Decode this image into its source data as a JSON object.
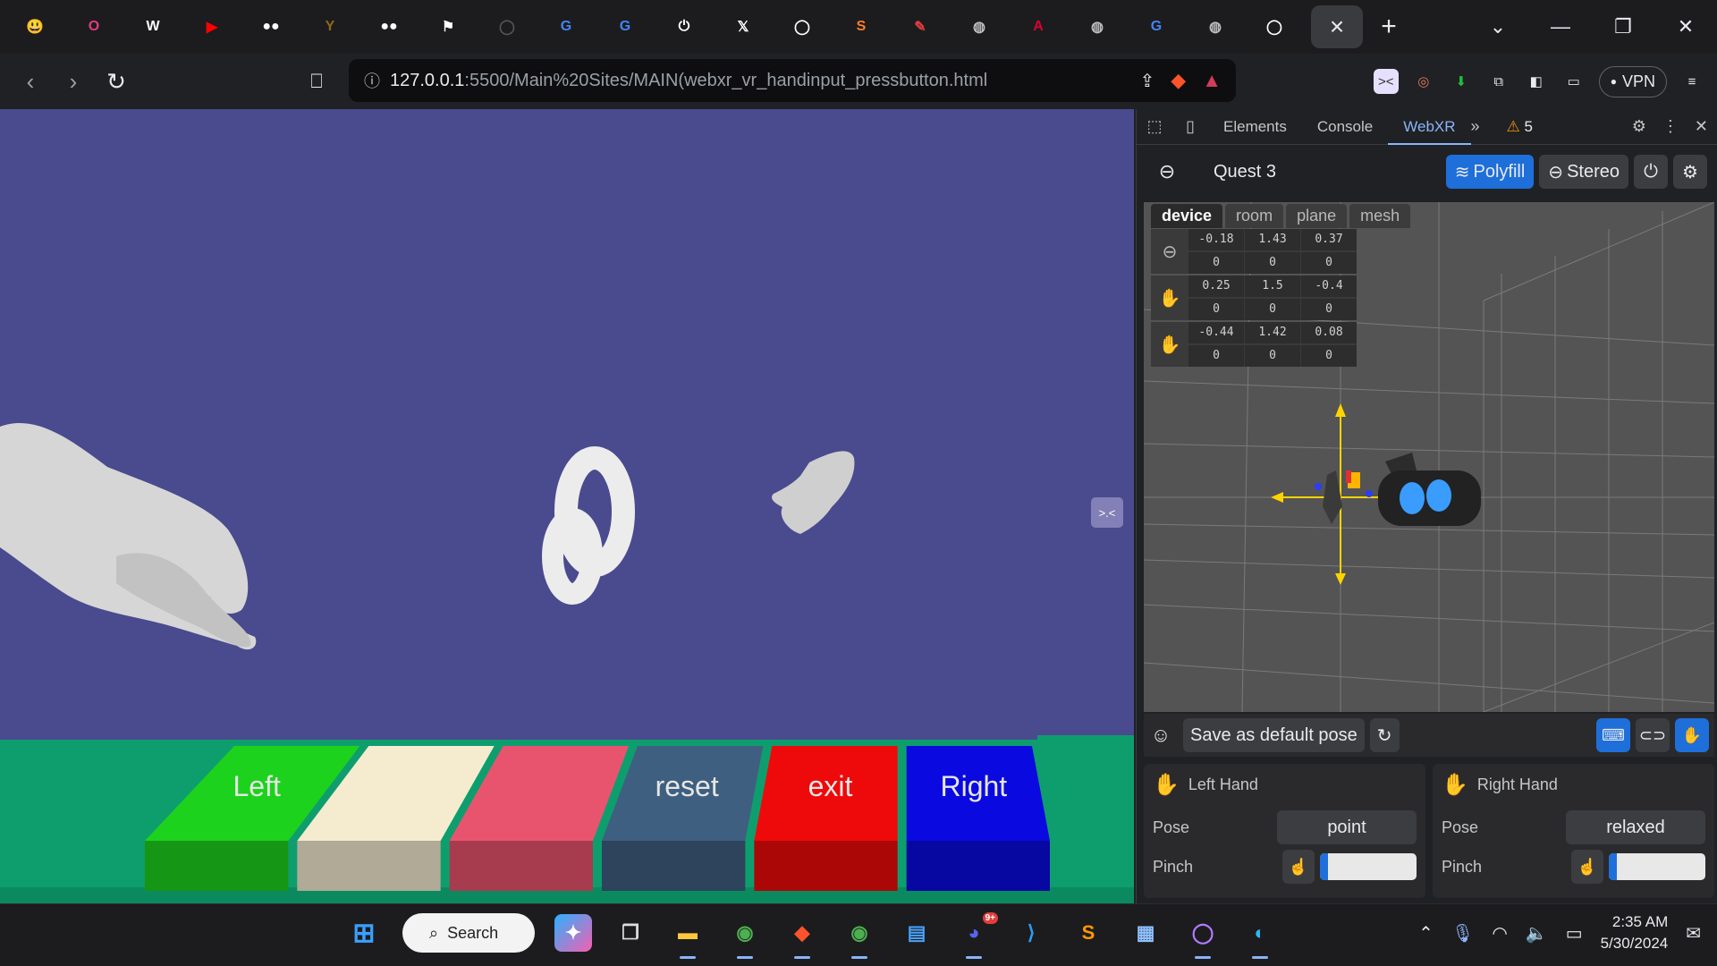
{
  "browser": {
    "tabs": [
      {
        "icon": "emoji-face-icon",
        "color": "#f4c542",
        "glyph": "😃"
      },
      {
        "icon": "square-o-icon",
        "color": "#e23c7d",
        "glyph": "O"
      },
      {
        "icon": "wikipedia-icon",
        "color": "#ffffff",
        "glyph": "W"
      },
      {
        "icon": "youtube-icon",
        "color": "#ff0000",
        "glyph": "▶"
      },
      {
        "icon": "medium-icon",
        "color": "#ffffff",
        "glyph": "●●"
      },
      {
        "icon": "antler-icon",
        "color": "#8a6a1c",
        "glyph": "Y"
      },
      {
        "icon": "medium-icon",
        "color": "#ffffff",
        "glyph": "●●"
      },
      {
        "icon": "flag-icon",
        "color": "#ffffff",
        "glyph": "⚑"
      },
      {
        "icon": "github-icon",
        "color": "#555555",
        "glyph": "◯"
      },
      {
        "icon": "google-icon",
        "color": "#4285f4",
        "glyph": "G"
      },
      {
        "icon": "google-icon",
        "color": "#4285f4",
        "glyph": "G"
      },
      {
        "icon": "power-icon",
        "color": "#ffffff",
        "glyph": "⏻"
      },
      {
        "icon": "x-icon",
        "color": "#ffffff",
        "glyph": "𝕏"
      },
      {
        "icon": "github-icon",
        "color": "#ffffff",
        "glyph": "◯"
      },
      {
        "icon": "sublime-icon",
        "color": "#ff7d26",
        "glyph": "S"
      },
      {
        "icon": "pen-icon",
        "color": "#e23c3c",
        "glyph": "✎"
      },
      {
        "icon": "globe-icon",
        "color": "#c0c0c0",
        "glyph": "◍"
      },
      {
        "icon": "angular-icon",
        "color": "#dd0031",
        "glyph": "A"
      },
      {
        "icon": "globe-icon",
        "color": "#c0c0c0",
        "glyph": "◍"
      },
      {
        "icon": "google-icon",
        "color": "#4285f4",
        "glyph": "G"
      },
      {
        "icon": "globe-icon",
        "color": "#c0c0c0",
        "glyph": "◍"
      },
      {
        "icon": "github-icon",
        "color": "#ffffff",
        "glyph": "◯"
      }
    ],
    "active_tab_close": "×",
    "new_tab": "+",
    "url_host": "127.0.0.1",
    "url_path": ":5500/Main%20Sites/MAIN(webxr_vr_handinput_pressbutton.html",
    "vpn_label": "VPN"
  },
  "scene": {
    "collapse_label": ">.<",
    "buttons": [
      {
        "label": "Left",
        "color": "#1dd21d"
      },
      {
        "label": "",
        "color": "#f5ecd0"
      },
      {
        "label": "",
        "color": "#e8546e"
      },
      {
        "label": "reset",
        "color": "#3e5f80"
      },
      {
        "label": "exit",
        "color": "#ee0a0a"
      },
      {
        "label": "Right",
        "color": "#0a0ae0"
      }
    ]
  },
  "devtools": {
    "tabs": [
      "Elements",
      "Console",
      "WebXR"
    ],
    "active_tab": "WebXR",
    "warnings": "5",
    "device_name": "Quest 3",
    "polyfill_label": "Polyfill",
    "stereo_label": "Stereo",
    "scene_tabs": [
      "device",
      "room",
      "plane",
      "mesh"
    ],
    "poses": [
      {
        "icon": "headset-icon",
        "values": [
          "-0.18",
          "1.43",
          "0.37",
          "0",
          "0",
          "0"
        ]
      },
      {
        "icon": "left-hand-icon",
        "values": [
          "0.25",
          "1.5",
          "-0.4",
          "0",
          "0",
          "0"
        ]
      },
      {
        "icon": "right-hand-icon",
        "values": [
          "-0.44",
          "1.42",
          "0.08",
          "0",
          "0",
          "0"
        ]
      }
    ],
    "save_pose_label": "Save as default pose",
    "left_hand": {
      "title": "Left Hand",
      "pose_label": "Pose",
      "pose_value": "point",
      "pinch_label": "Pinch",
      "pinch_level": 0.08
    },
    "right_hand": {
      "title": "Right Hand",
      "pose_label": "Pose",
      "pose_value": "relaxed",
      "pinch_label": "Pinch",
      "pinch_level": 0.08
    }
  },
  "taskbar": {
    "search_label": "Search",
    "time": "2:35 AM",
    "date": "5/30/2024",
    "discord_badge": "9+"
  }
}
